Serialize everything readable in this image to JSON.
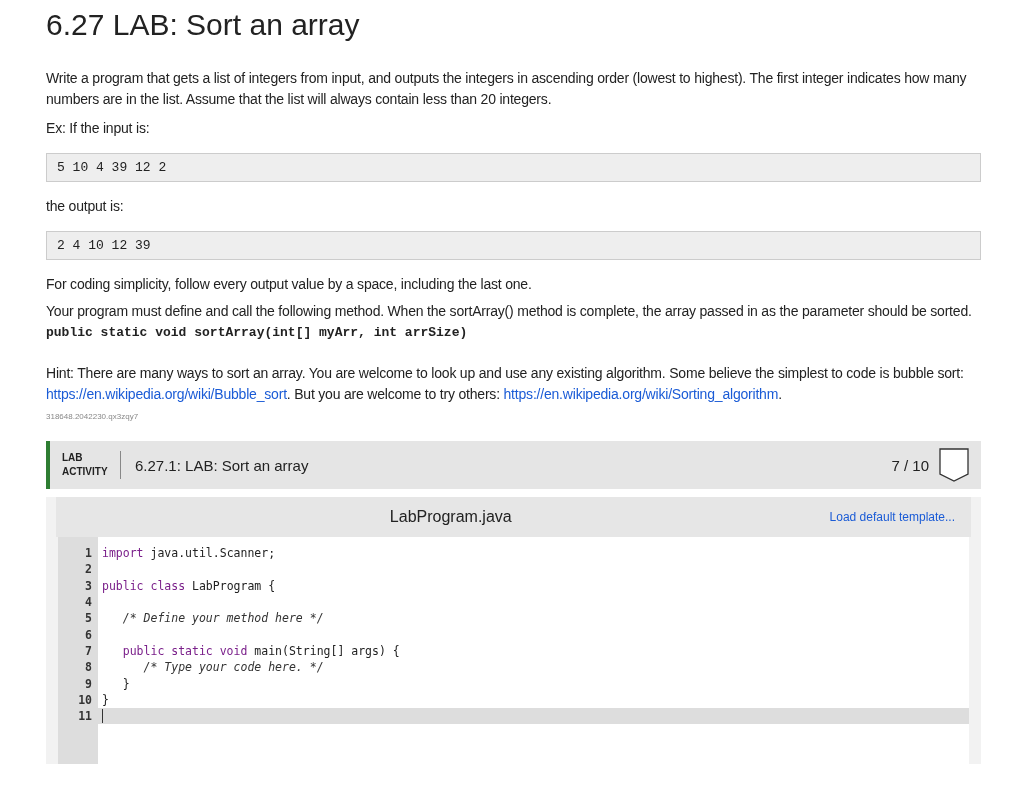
{
  "title": "6.27 LAB: Sort an array",
  "intro": "Write a program that gets a list of integers from input, and outputs the integers in ascending order (lowest to highest). The first integer indicates how many numbers are in the list. Assume that the list will always contain less than 20 integers.",
  "example_input_label": "Ex: If the input is:",
  "example_input": "5 10 4 39 12 2",
  "example_output_label": "the output is:",
  "example_output": "2 4 10 12 39",
  "note": "For coding simplicity, follow every output value by a space, including the last one.",
  "method_text": "Your program must define and call the following method. When the sortArray() method is complete, the array passed in as the parameter should be sorted.",
  "method_signature": "public static void sortArray(int[] myArr, int arrSize)",
  "hint": [
    {
      "kind": "text",
      "text": "Hint: There are many ways to sort an array. You are welcome to look up and use any existing algorithm. Some believe the simplest to code is bubble sort: "
    },
    {
      "kind": "link",
      "text": "https://en.wikipedia.org/wiki/Bubble_sort"
    },
    {
      "kind": "text",
      "text": ". But you are welcome to try others: "
    },
    {
      "kind": "link",
      "text": "https://en.wikipedia.org/wiki/Sorting_algorithm"
    },
    {
      "kind": "text",
      "text": "."
    }
  ],
  "problem_id": "318648.2042230.qx3zqy7",
  "activity": {
    "type_label": "LAB ACTIVITY",
    "title": "6.27.1: LAB: Sort an array",
    "score": "7 / 10"
  },
  "editor": {
    "filename": "LabProgram.java",
    "template_link": "Load default template...",
    "lines": [
      {
        "number": "1",
        "current": false,
        "segments": [
          {
            "kind": "keyword",
            "text": "import"
          },
          {
            "kind": "plain",
            "text": " java.util.Scanner;"
          }
        ]
      },
      {
        "number": "2",
        "current": false
      },
      {
        "number": "3",
        "current": false,
        "segments": [
          {
            "kind": "keyword",
            "text": "public class"
          },
          {
            "kind": "plain",
            "text": " LabProgram {"
          }
        ]
      },
      {
        "number": "4",
        "current": false
      },
      {
        "number": "5",
        "current": false,
        "segments": [
          {
            "kind": "comment",
            "text": "   /* Define your method here */"
          }
        ]
      },
      {
        "number": "6",
        "current": false
      },
      {
        "number": "7",
        "current": false,
        "segments": [
          {
            "kind": "keyword",
            "text": "   public static void"
          },
          {
            "kind": "plain",
            "text": " main(String[] args) {"
          }
        ]
      },
      {
        "number": "8",
        "current": false,
        "segments": [
          {
            "kind": "comment",
            "text": "      /* Type your code here. */"
          }
        ]
      },
      {
        "number": "9",
        "current": false,
        "segments": [
          {
            "kind": "plain",
            "text": "   }"
          }
        ]
      },
      {
        "number": "10",
        "current": false,
        "segments": [
          {
            "kind": "plain",
            "text": "}"
          }
        ]
      },
      {
        "number": "11",
        "current": true
      }
    ]
  }
}
